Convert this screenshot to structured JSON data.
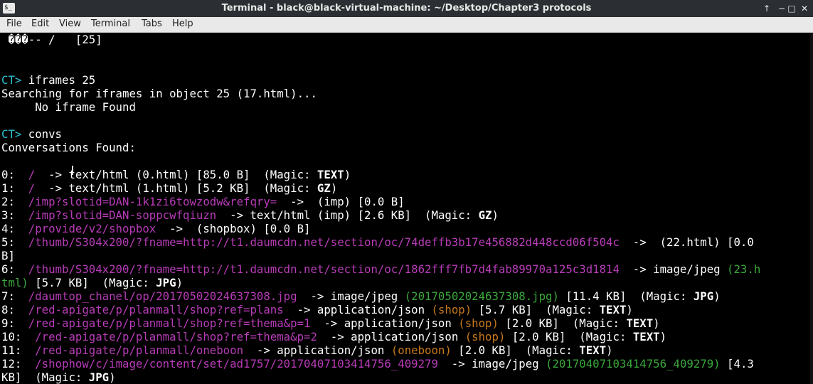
{
  "window": {
    "title": "Terminal - black@black-virtual-machine: ~/Desktop/Chapter3 protocols",
    "app_icon_glyph": "$_",
    "buttons": [
      "↑",
      "−",
      "□",
      "✕"
    ]
  },
  "menubar": {
    "items": [
      "File",
      "Edit",
      "View",
      "Terminal",
      "Tabs",
      "Help"
    ]
  },
  "colors": {
    "prompt": "#2ec0d0",
    "path": "#b83cb8",
    "orange": "#c7791c",
    "green": "#3ba83b",
    "text": "#ffffff",
    "background": "#000000"
  },
  "terminal": {
    "lines": [
      [
        {
          "t": " ���-- /   [25]"
        }
      ],
      [
        {
          "t": ""
        }
      ],
      [
        {
          "t": ""
        }
      ],
      [
        {
          "t": "CT> ",
          "c": "pr"
        },
        {
          "t": "iframes 25"
        }
      ],
      [
        {
          "t": "Searching for iframes in object 25 (17.html)..."
        }
      ],
      [
        {
          "t": "     No iframe Found"
        }
      ],
      [
        {
          "t": ""
        }
      ],
      [
        {
          "t": "CT> ",
          "c": "pr"
        },
        {
          "t": "convs"
        }
      ],
      [
        {
          "t": "Conversations Found:"
        }
      ],
      [
        {
          "t": ""
        }
      ],
      [
        {
          "t": "0:  "
        },
        {
          "t": "/",
          "c": "mg"
        },
        {
          "t": "  -> text/html (0.html) [85.0 B]  (Magic: "
        },
        {
          "t": "TEXT",
          "c": "wb"
        },
        {
          "t": ")"
        }
      ],
      [
        {
          "t": "1:  "
        },
        {
          "t": "/",
          "c": "mg"
        },
        {
          "t": "  -> text/html (1.html) [5.2 KB]  (Magic: "
        },
        {
          "t": "GZ",
          "c": "wb"
        },
        {
          "t": ")"
        }
      ],
      [
        {
          "t": "2:  "
        },
        {
          "t": "/imp?slotid=DAN-1k1zi6towzodw&refqry=",
          "c": "mg"
        },
        {
          "t": "  ->  (imp) [0.0 B]"
        }
      ],
      [
        {
          "t": "3:  "
        },
        {
          "t": "/imp?slotid=DAN-soppcwfqiuzn",
          "c": "mg"
        },
        {
          "t": "  -> text/html (imp) [2.6 KB]  (Magic: "
        },
        {
          "t": "GZ",
          "c": "wb"
        },
        {
          "t": ")"
        }
      ],
      [
        {
          "t": "4:  "
        },
        {
          "t": "/provide/v2/shopbox",
          "c": "mg"
        },
        {
          "t": "  ->  (shopbox) [0.0 B]"
        }
      ],
      [
        {
          "t": "5:  "
        },
        {
          "t": "/thumb/S304x200/?fname=http://t1.daumcdn.net/section/oc/74deffb3b17e456882d448ccd06f504c",
          "c": "mg"
        },
        {
          "t": "  ->  (22.html) [0.0"
        }
      ],
      [
        {
          "t": "B]"
        }
      ],
      [
        {
          "t": "6:  "
        },
        {
          "t": "/thumb/S304x200/?fname=http://t1.daumcdn.net/section/oc/1862fff7fb7d4fab89970a125c3d1814",
          "c": "mg"
        },
        {
          "t": "  -> image/jpeg "
        },
        {
          "t": "(23.h",
          "c": "gr"
        }
      ],
      [
        {
          "t": "tml)",
          "c": "gr"
        },
        {
          "t": " [5.7 KB]  (Magic: "
        },
        {
          "t": "JPG",
          "c": "wb"
        },
        {
          "t": ")"
        }
      ],
      [
        {
          "t": "7:  "
        },
        {
          "t": "/daumtop_chanel/op/20170502024637308.jpg",
          "c": "mg"
        },
        {
          "t": "  -> image/jpeg "
        },
        {
          "t": "(20170502024637308.jpg)",
          "c": "gr"
        },
        {
          "t": " [11.4 KB]  (Magic: "
        },
        {
          "t": "JPG",
          "c": "wb"
        },
        {
          "t": ")"
        }
      ],
      [
        {
          "t": "8:  "
        },
        {
          "t": "/red-apigate/p/planmall/shop?ref=plans",
          "c": "mg"
        },
        {
          "t": "  -> application/json "
        },
        {
          "t": "(shop)",
          "c": "og"
        },
        {
          "t": " [5.7 KB]  (Magic: "
        },
        {
          "t": "TEXT",
          "c": "wb"
        },
        {
          "t": ")"
        }
      ],
      [
        {
          "t": "9:  "
        },
        {
          "t": "/red-apigate/p/planmall/shop?ref=thema&p=1",
          "c": "mg"
        },
        {
          "t": "  -> application/json "
        },
        {
          "t": "(shop)",
          "c": "og"
        },
        {
          "t": " [2.0 KB]  (Magic: "
        },
        {
          "t": "TEXT",
          "c": "wb"
        },
        {
          "t": ")"
        }
      ],
      [
        {
          "t": "10:  "
        },
        {
          "t": "/red-apigate/p/planmall/shop?ref=thema&p=2",
          "c": "mg"
        },
        {
          "t": "  -> application/json "
        },
        {
          "t": "(shop)",
          "c": "og"
        },
        {
          "t": " [2.0 KB]  (Magic: "
        },
        {
          "t": "TEXT",
          "c": "wb"
        },
        {
          "t": ")"
        }
      ],
      [
        {
          "t": "11:  "
        },
        {
          "t": "/red-apigate/p/planmall/oneboon",
          "c": "mg"
        },
        {
          "t": "  -> application/json "
        },
        {
          "t": "(oneboon)",
          "c": "og"
        },
        {
          "t": " [2.0 KB]  (Magic: "
        },
        {
          "t": "TEXT",
          "c": "wb"
        },
        {
          "t": ")"
        }
      ],
      [
        {
          "t": "12:  "
        },
        {
          "t": "/shophow/c/image/content/set/ad1757/20170407103414756_409279",
          "c": "mg"
        },
        {
          "t": "  -> image/jpeg "
        },
        {
          "t": "(20170407103414756_409279)",
          "c": "gr"
        },
        {
          "t": " [4.3"
        }
      ],
      [
        {
          "t": "KB]  (Magic: "
        },
        {
          "t": "JPG",
          "c": "wb"
        },
        {
          "t": ")"
        }
      ]
    ]
  }
}
